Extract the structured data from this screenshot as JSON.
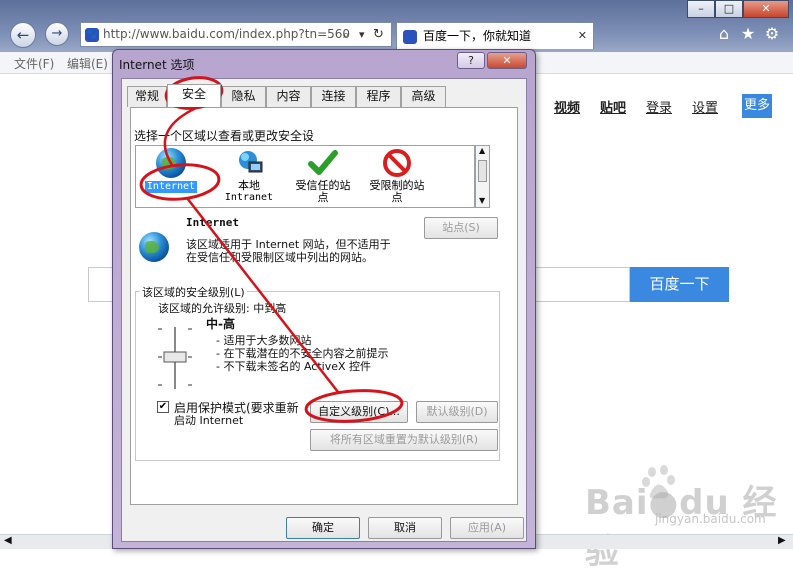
{
  "browser": {
    "address_url": "http://www.baidu.com/index.php?tn=560",
    "address_search_glyph": "⌕",
    "address_dropdown_glyph": "▾",
    "address_refresh_glyph": "↻",
    "tab_title": "百度一下，你就知道",
    "tab_close_glyph": "✕",
    "back_glyph": "←",
    "forward_glyph": "→",
    "window_buttons": {
      "minimize": "–",
      "maximize": "□",
      "close": "✕"
    },
    "toolbar_icons": {
      "home": "⌂",
      "favorites": "★",
      "tools": "⚙"
    },
    "menu": {
      "file": "文件(F)",
      "edit": "编辑(E)"
    }
  },
  "baidu_page": {
    "links": {
      "video": "视频",
      "tieba": "贴吧",
      "login": "登录",
      "settings": "设置",
      "more": "更多"
    },
    "search_button": "百度一下",
    "watermark": {
      "logo": "Bai●du 经验",
      "url": "jingyan.baidu.com"
    }
  },
  "dialog": {
    "title": "Internet 选项",
    "help_glyph": "?",
    "close_glyph": "✕",
    "tabs": [
      "常规",
      "安全",
      "隐私",
      "内容",
      "连接",
      "程序",
      "高级"
    ],
    "active_tab": "安全",
    "zone_prompt": "选择一个区域以查看或更改安全设",
    "zones": [
      {
        "line1": "Internet",
        "line2": "",
        "icon": "globe-icon"
      },
      {
        "line1": "本地",
        "line2": "Intranet",
        "icon": "computer-icon"
      },
      {
        "line1": "受信任的站",
        "line2": "点",
        "icon": "checkmark-icon"
      },
      {
        "line1": "受限制的站",
        "line2": "点",
        "icon": "no-entry-icon"
      }
    ],
    "zone_name": "Internet",
    "zone_desc_line1": "该区域适用于 Internet 网站，但不适用于",
    "zone_desc_line2": "在受信任和受限制区域中列出的网站。",
    "sites_button": "站点(S)",
    "security_level_group": "该区域的安全级别(L)",
    "allowed_levels": "该区域的允许级别: 中到高",
    "level_name": "中-高",
    "level_desc": [
      "- 适用于大多数网站",
      "- 在下载潜在的不安全内容之前提示",
      "- 不下载未签名的 ActiveX 控件"
    ],
    "protected_mode_line1": "启用保护模式(要求重新",
    "protected_mode_line2": "启动 Internet",
    "protected_mode_checked": true,
    "checkmark_glyph": "✔",
    "custom_level_button": "自定义级别(C)...",
    "default_level_button": "默认级别(D)",
    "reset_all_button": "将所有区域重置为默认级别(R)",
    "ok_button": "确定",
    "cancel_button": "取消",
    "apply_button": "应用(A)"
  },
  "colors": {
    "annotation_red": "#d4141a",
    "baidu_blue": "#3a88e0",
    "zone_highlight": "#3399ff"
  }
}
